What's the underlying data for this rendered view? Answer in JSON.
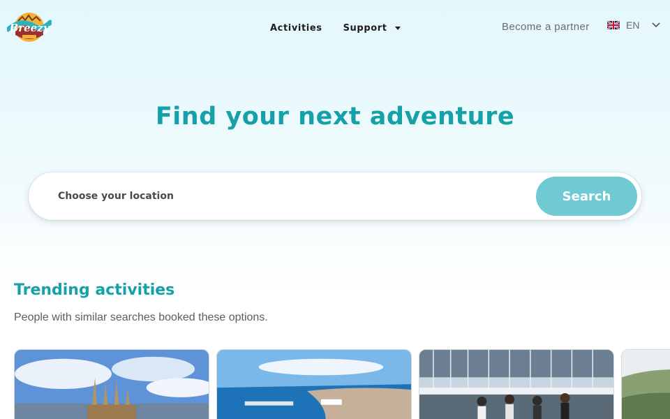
{
  "header": {
    "logo_alt": "Breezy Tracks",
    "nav": {
      "activities_label": "Activities",
      "support_label": "Support"
    },
    "partner_label": "Become a partner",
    "language": {
      "code": "EN",
      "flag_icon": "uk-flag-icon"
    }
  },
  "hero": {
    "title": "Find your next adventure",
    "search": {
      "placeholder": "Choose your location",
      "value": "",
      "button_label": "Search"
    }
  },
  "trending": {
    "title": "Trending activities",
    "subtitle": "People with similar searches booked these options.",
    "cards": [
      {
        "name": "barcelona-sagrada-familia"
      },
      {
        "name": "coastal-city-port"
      },
      {
        "name": "marina-bike-tour"
      },
      {
        "name": "green-hills"
      }
    ]
  },
  "colors": {
    "accent": "#16a0a8",
    "search_button": "#6fcad3"
  }
}
